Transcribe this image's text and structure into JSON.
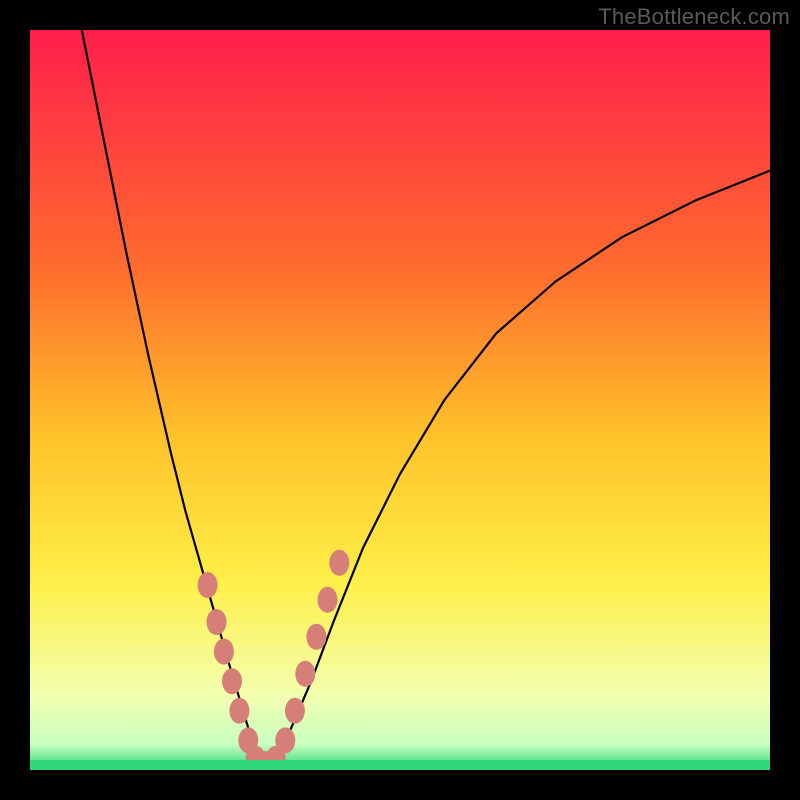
{
  "watermark": "TheBottleneck.com",
  "colors": {
    "frame": "#000000",
    "gradient_top": "#ff1e4c",
    "gradient_mid1": "#ff8a2a",
    "gradient_mid2": "#ffe22a",
    "gradient_low": "#f6ff9a",
    "gradient_base": "#2fd67a",
    "curve": "#000000",
    "marker": "#d67f78",
    "watermark": "#5a5a5a"
  },
  "chart_data": {
    "type": "line",
    "title": "",
    "xlabel": "",
    "ylabel": "",
    "xlim": [
      0,
      100
    ],
    "ylim": [
      0,
      100
    ],
    "grid": false,
    "legend": false,
    "annotations": [
      "TheBottleneck.com"
    ],
    "series": [
      {
        "name": "left-branch",
        "x": [
          7,
          10,
          13,
          16,
          19,
          21,
          23,
          25,
          27,
          28.5,
          30,
          31
        ],
        "y": [
          100,
          85,
          70,
          56,
          43,
          35,
          28,
          21,
          14,
          9,
          4,
          1
        ]
      },
      {
        "name": "right-branch",
        "x": [
          33,
          35,
          38,
          41,
          45,
          50,
          56,
          63,
          71,
          80,
          90,
          100
        ],
        "y": [
          1,
          5,
          12,
          20,
          30,
          40,
          50,
          59,
          66,
          72,
          77,
          81
        ]
      }
    ],
    "markers": {
      "name": "highlight-dots",
      "points": [
        {
          "x": 24.0,
          "y": 25
        },
        {
          "x": 25.2,
          "y": 20
        },
        {
          "x": 26.2,
          "y": 16
        },
        {
          "x": 27.3,
          "y": 12
        },
        {
          "x": 28.3,
          "y": 8
        },
        {
          "x": 29.5,
          "y": 4
        },
        {
          "x": 30.5,
          "y": 1.5
        },
        {
          "x": 31.8,
          "y": 0.8
        },
        {
          "x": 33.2,
          "y": 1.5
        },
        {
          "x": 34.5,
          "y": 4
        },
        {
          "x": 35.8,
          "y": 8
        },
        {
          "x": 37.2,
          "y": 13
        },
        {
          "x": 38.7,
          "y": 18
        },
        {
          "x": 40.2,
          "y": 23
        },
        {
          "x": 41.8,
          "y": 28
        }
      ]
    },
    "gradient_stops": [
      {
        "offset": 0.0,
        "color": "#ff1e4c"
      },
      {
        "offset": 0.32,
        "color": "#ff6b2d"
      },
      {
        "offset": 0.55,
        "color": "#ffc22a"
      },
      {
        "offset": 0.75,
        "color": "#fff04a"
      },
      {
        "offset": 0.9,
        "color": "#f2ffb0"
      },
      {
        "offset": 0.965,
        "color": "#c8ffc0"
      },
      {
        "offset": 1.0,
        "color": "#2fd67a"
      }
    ]
  }
}
